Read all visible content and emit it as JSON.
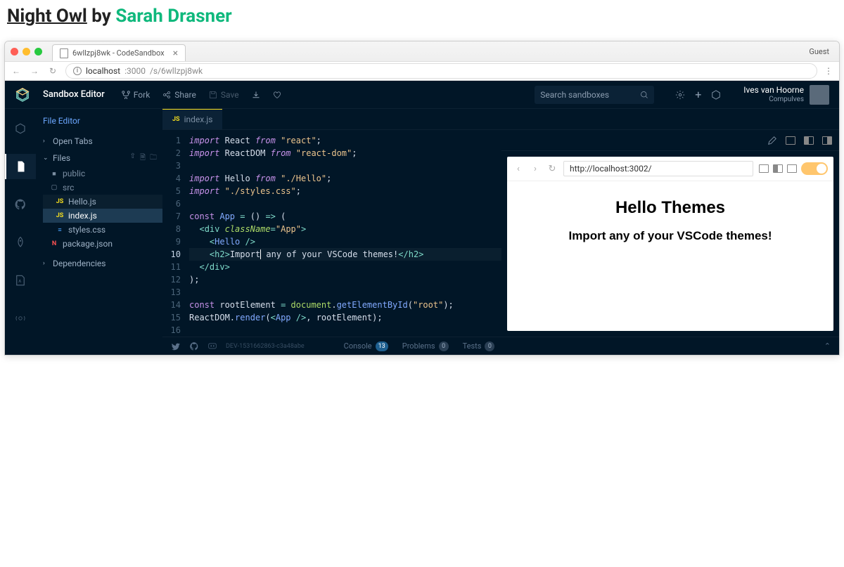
{
  "pageHeader": {
    "themeName": "Night Owl",
    "by": "by",
    "author": "Sarah Drasner"
  },
  "browser": {
    "tabTitle": "6wllzpj8wk - CodeSandbox",
    "guest": "Guest",
    "urlHost": "localhost",
    "urlPort": ":3000",
    "urlPath": "/s/6wllzpj8wk"
  },
  "topbar": {
    "brand": "Sandbox Editor",
    "fork": "Fork",
    "share": "Share",
    "save": "Save",
    "searchPlaceholder": "Search sandboxes",
    "user": {
      "name": "Ives van Hoorne",
      "sub": "Compulves"
    }
  },
  "sidebar": {
    "title": "File Editor",
    "sections": {
      "openTabs": "Open Tabs",
      "files": "Files",
      "dependencies": "Dependencies"
    },
    "tree": {
      "public": "public",
      "src": "src",
      "hello": "Hello.js",
      "index": "index.js",
      "styles": "styles.css",
      "package": "package.json"
    }
  },
  "fileTab": {
    "name": "index.js"
  },
  "code": {
    "lines": [
      "1",
      "2",
      "3",
      "4",
      "5",
      "6",
      "7",
      "8",
      "9",
      "10",
      "11",
      "12",
      "13",
      "14",
      "15",
      "16"
    ]
  },
  "preview": {
    "url": "http://localhost:3002/",
    "h1": "Hello Themes",
    "h2": "Import any of your VSCode themes!"
  },
  "status": {
    "dev": "DEV-1531662863-c3a48abe",
    "console": "Console",
    "consoleCount": "13",
    "problems": "Problems",
    "problemsCount": "0",
    "tests": "Tests",
    "testsCount": "0"
  }
}
